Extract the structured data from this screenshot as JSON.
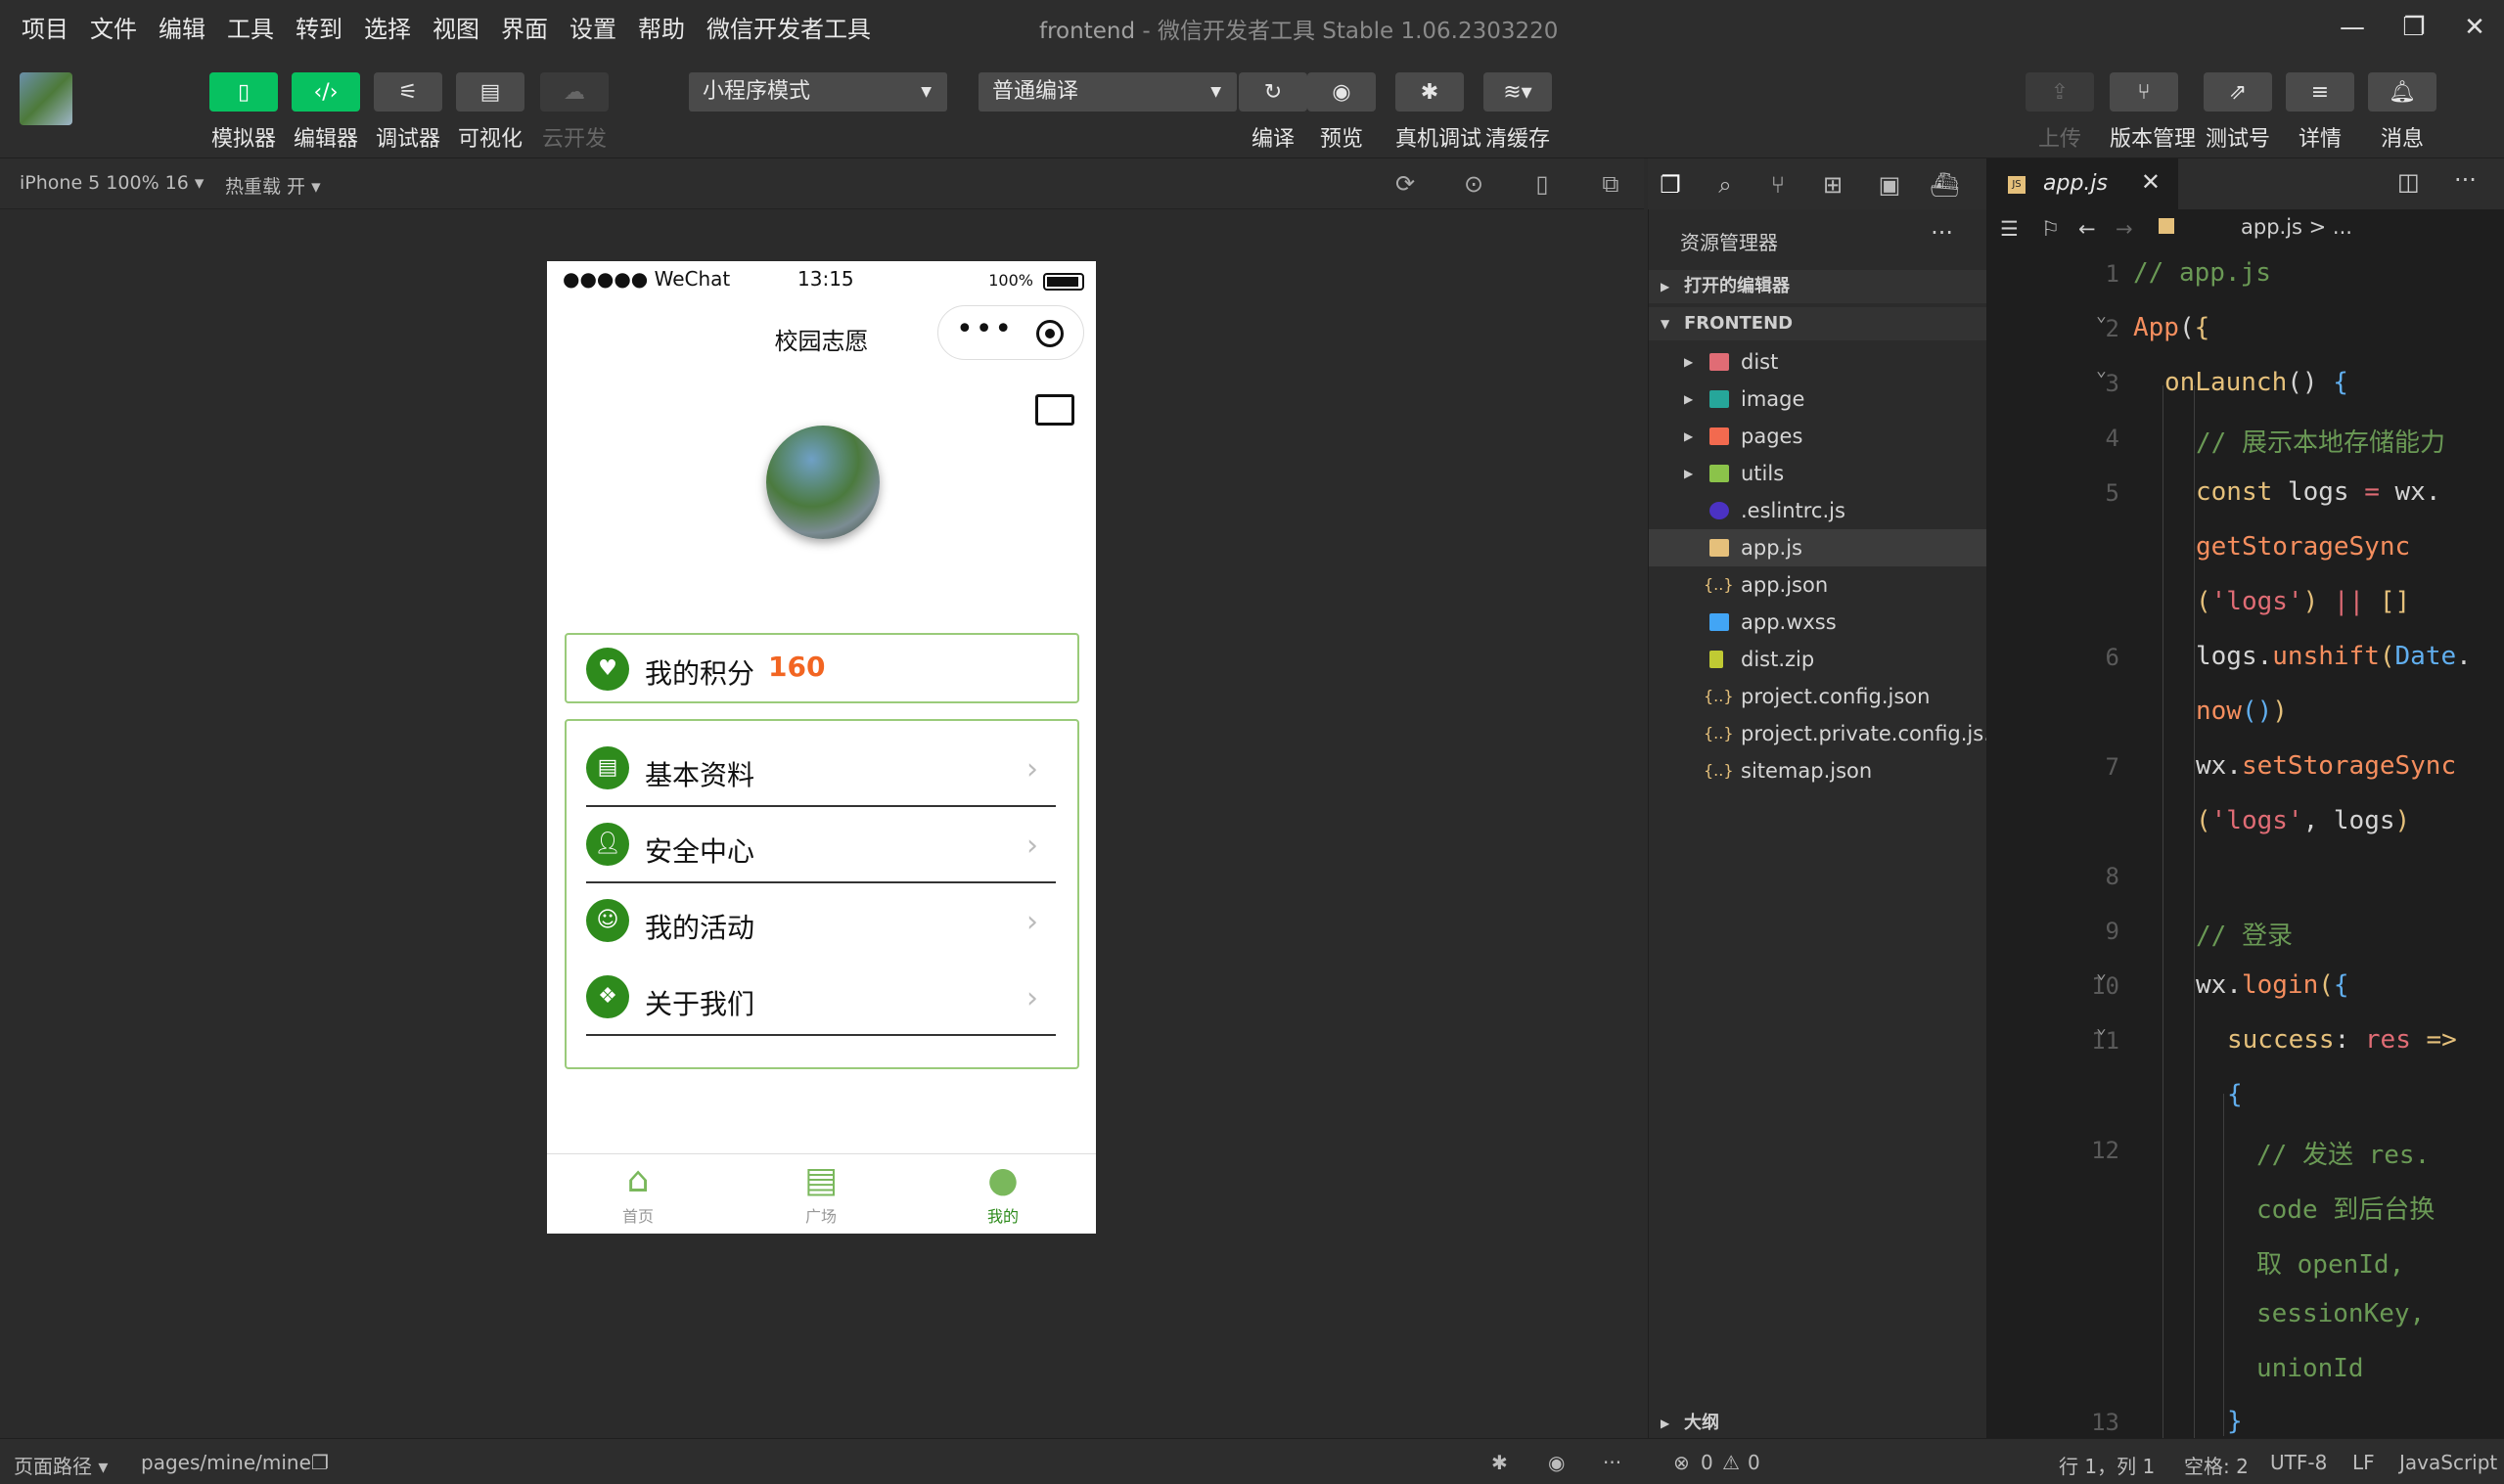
{
  "menubar": {
    "items": [
      "项目",
      "文件",
      "编辑",
      "工具",
      "转到",
      "选择",
      "视图",
      "界面",
      "设置",
      "帮助",
      "微信开发者工具"
    ],
    "window_title": "frontend",
    "window_subtitle": "- 微信开发者工具 Stable 1.06.2303220"
  },
  "toolbar": {
    "simulator": "模拟器",
    "editor": "编辑器",
    "debugger": "调试器",
    "visual": "可视化",
    "cloud": "云开发",
    "mode_select": "小程序模式",
    "compile_select": "普通编译",
    "compile": "编译",
    "preview": "预览",
    "real_debug": "真机调试",
    "clear_cache": "清缓存",
    "upload": "上传",
    "version": "版本管理",
    "test_account": "测试号",
    "details": "详情",
    "messages": "消息"
  },
  "simbar": {
    "device": "iPhone 5 100% 16",
    "hot_reload": "热重载 开"
  },
  "phone": {
    "carrier": "●●●●● WeChat",
    "time": "13:15",
    "battery": "100%",
    "title": "校园志愿",
    "points_label": "我的积分",
    "points_value": "160",
    "menu": [
      {
        "label": "基本资料"
      },
      {
        "label": "安全中心"
      },
      {
        "label": "我的活动"
      },
      {
        "label": "关于我们"
      }
    ],
    "tabs": [
      "首页",
      "广场",
      "我的"
    ]
  },
  "explorer": {
    "title": "资源管理器",
    "open_editors": "打开的编辑器",
    "project": "FRONTEND",
    "outline": "大纲",
    "files": [
      {
        "name": "dist",
        "type": "folder"
      },
      {
        "name": "image",
        "type": "folder"
      },
      {
        "name": "pages",
        "type": "folder"
      },
      {
        "name": "utils",
        "type": "folder"
      },
      {
        "name": ".eslintrc.js",
        "type": "eslint"
      },
      {
        "name": "app.js",
        "type": "js"
      },
      {
        "name": "app.json",
        "type": "json"
      },
      {
        "name": "app.wxss",
        "type": "wxss"
      },
      {
        "name": "dist.zip",
        "type": "zip"
      },
      {
        "name": "project.config.json",
        "type": "json"
      },
      {
        "name": "project.private.config.js...",
        "type": "json"
      },
      {
        "name": "sitemap.json",
        "type": "json"
      }
    ]
  },
  "editor": {
    "tab": "app.js",
    "breadcrumb": "app.js > ...",
    "line_numbers": [
      "1",
      "2",
      "3",
      "4",
      "5",
      "6",
      "7",
      "8",
      "9",
      "10",
      "11",
      "12",
      "13"
    ]
  },
  "statusbar": {
    "page_path_label": "页面路径",
    "page_path": "pages/mine/mine",
    "errors": "0",
    "warnings": "0",
    "position": "行 1，列 1",
    "indent": "空格: 2",
    "encoding": "UTF-8",
    "eol": "LF",
    "language": "JavaScript"
  },
  "colors": {
    "accent_green": "#07c160",
    "points_orange": "#f26522",
    "border_green": "#9acb7a"
  }
}
